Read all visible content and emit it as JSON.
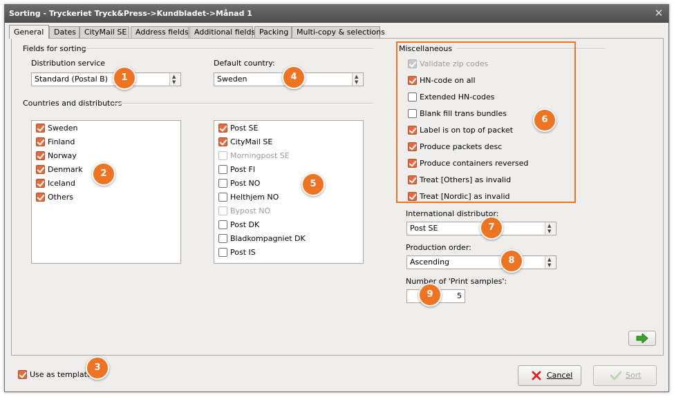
{
  "window": {
    "title": "Sorting - Tryckeriet Tryck&Press->Kundbladet->Månad 1",
    "close_glyph": "✕"
  },
  "tabs": [
    {
      "label": "General",
      "active": true
    },
    {
      "label": "Dates"
    },
    {
      "label": "CityMail SE"
    },
    {
      "label": "Address fields"
    },
    {
      "label": "Additional fields"
    },
    {
      "label": "Packing"
    },
    {
      "label": "Multi-copy & selections"
    }
  ],
  "fields_for_sorting": {
    "heading": "Fields for sorting",
    "distribution_service_label": "Distribution service",
    "distribution_service_value": "Standard (Postal B)",
    "default_country_label": "Default country:",
    "default_country_value": "Sweden"
  },
  "countries": {
    "heading": "Countries and distributors",
    "items": [
      {
        "label": "Sweden",
        "checked": true
      },
      {
        "label": "Finland",
        "checked": true
      },
      {
        "label": "Norway",
        "checked": true
      },
      {
        "label": "Denmark",
        "checked": true
      },
      {
        "label": "Iceland",
        "checked": true
      },
      {
        "label": "Others",
        "checked": true
      }
    ]
  },
  "distributors": {
    "items": [
      {
        "label": "Post SE",
        "checked": true
      },
      {
        "label": "CityMail SE",
        "checked": true
      },
      {
        "label": "Morningpost SE",
        "checked": false,
        "disabled": true
      },
      {
        "label": "Post FI",
        "checked": false
      },
      {
        "label": "Post NO",
        "checked": false
      },
      {
        "label": "Helthjem NO",
        "checked": false
      },
      {
        "label": "Bypost NO",
        "checked": false,
        "disabled": true
      },
      {
        "label": "Post DK",
        "checked": false
      },
      {
        "label": "Bladkompagniet DK",
        "checked": false
      },
      {
        "label": "Post IS",
        "checked": false
      }
    ]
  },
  "misc": {
    "heading": "Miscellaneous",
    "items": [
      {
        "label": "Validate zip codes",
        "checked": true,
        "disabled": true
      },
      {
        "label": "HN-code on all",
        "checked": true
      },
      {
        "label": "Extended HN-codes",
        "checked": false
      },
      {
        "label": "Blank fill trans bundles",
        "checked": false
      },
      {
        "label": "Label is on top of packet",
        "checked": true
      },
      {
        "label": "Produce packets desc",
        "checked": true
      },
      {
        "label": "Produce containers reversed",
        "checked": true
      },
      {
        "label": "Treat [Others] as invalid",
        "checked": true
      },
      {
        "label": "Treat [Nordic] as invalid",
        "checked": true
      }
    ],
    "international_distributor_label": "International distributor:",
    "international_distributor_value": "Post SE",
    "production_order_label": "Production order:",
    "production_order_value": "Ascending",
    "print_samples_label": "Number of 'Print samples':",
    "print_samples_value": "5"
  },
  "footer": {
    "use_as_template_label": "Use as template",
    "use_as_template_checked": true,
    "cancel_label": "Cancel",
    "sort_label": "Sort"
  },
  "badges": [
    "1",
    "2",
    "3",
    "4",
    "5",
    "6",
    "7",
    "8",
    "9"
  ],
  "icons": {
    "next": "arrow-right-icon",
    "cancel": "red-x-icon",
    "sort": "green-check-icon"
  },
  "colors": {
    "check_orange": "#e06b3d",
    "badge_orange": "#ee7422",
    "title_bar": "#5a5a5a",
    "arrow_green": "#3aa32a"
  }
}
